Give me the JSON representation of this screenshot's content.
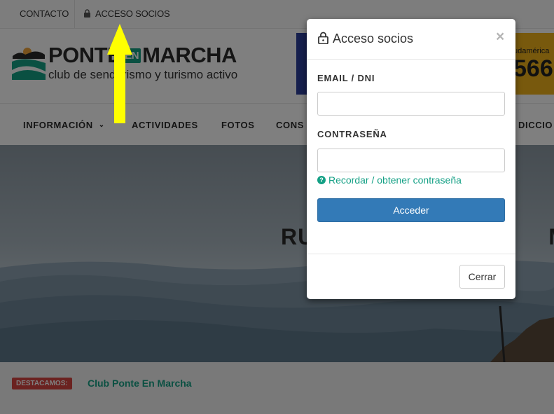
{
  "topbar": {
    "contact_label": "CONTACTO",
    "members_label": "ACCESO SOCIOS",
    "members_icon": "lock-icon"
  },
  "header": {
    "brand_part1": "PONTE",
    "brand_en": "EN",
    "brand_part2": "MARCHA",
    "tagline": "club de senderismo y turismo activo",
    "banner_text_small": "udamérica",
    "banner_text_big": "566"
  },
  "nav": {
    "items": [
      {
        "label": "INFORMACIÓN",
        "has_dropdown": true
      },
      {
        "label": "ACTIVIDADES"
      },
      {
        "label": "FOTOS"
      },
      {
        "label": "CONS"
      },
      {
        "label": "DICCIO"
      }
    ]
  },
  "hero": {
    "title_left": "RU",
    "title_right": "MO"
  },
  "featured": {
    "badge": "DESTACAMOS:",
    "link": "Club Ponte En Marcha"
  },
  "modal": {
    "title": "Acceso socios",
    "close_symbol": "×",
    "email_label": "EMAIL / DNI",
    "email_value": "",
    "password_label": "CONTRASEÑA",
    "password_value": "",
    "hint_icon": "?",
    "hint_text": "Recordar / obtener contraseña",
    "submit_label": "Acceder",
    "close_label": "Cerrar"
  },
  "colors": {
    "accent": "#14a085",
    "primary": "#337ab7",
    "badge": "#d64541",
    "arrow": "#ffff00"
  }
}
